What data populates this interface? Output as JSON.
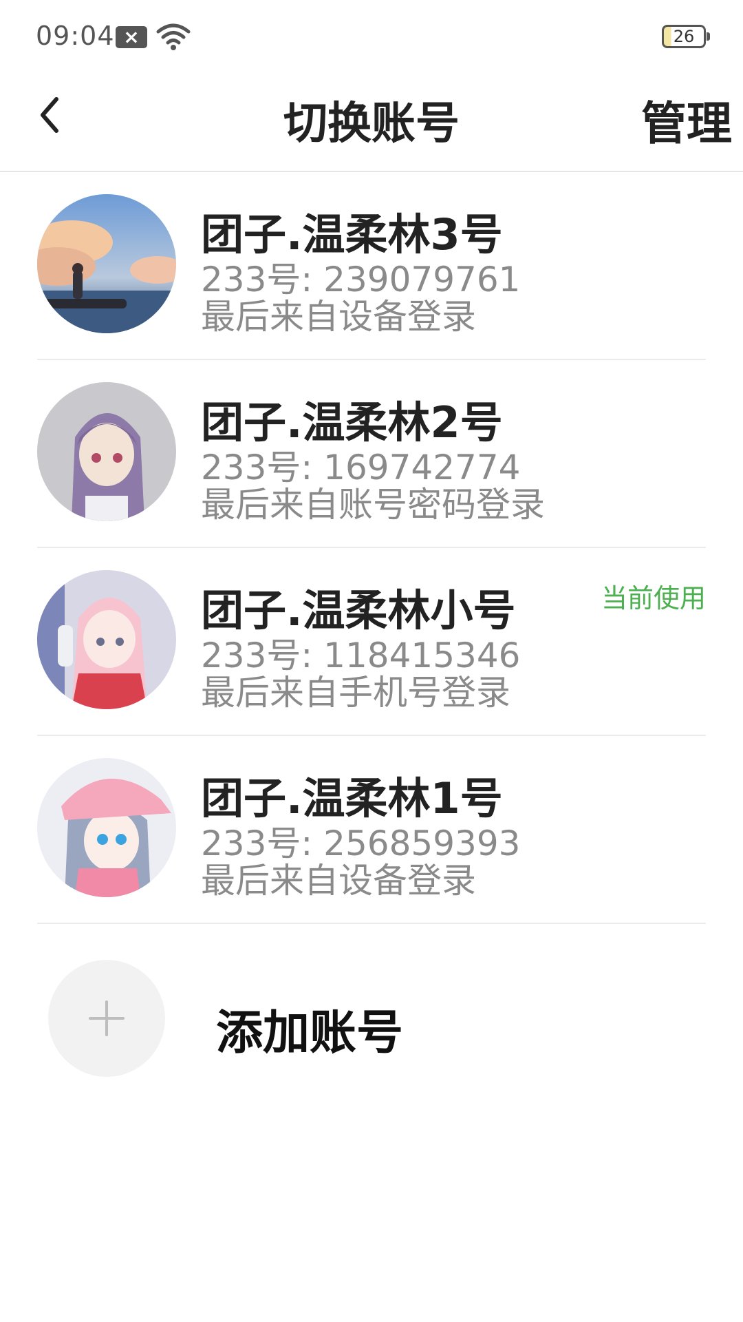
{
  "status_bar": {
    "time": "09:04",
    "battery": "26",
    "notification_icon": "close-box-icon",
    "wifi_icon": "wifi-icon"
  },
  "header": {
    "back_icon": "chevron-left-icon",
    "title": "切换账号",
    "manage_label": "管理"
  },
  "accounts": [
    {
      "name": "团子.温柔林3号",
      "id_text": "233号: 239079761",
      "login_text": "最后来自设备登录",
      "current": ""
    },
    {
      "name": "团子.温柔林2号",
      "id_text": "233号: 169742774",
      "login_text": "最后来自账号密码登录",
      "current": ""
    },
    {
      "name": "团子.温柔林小号",
      "id_text": "233号: 118415346",
      "login_text": "最后来自手机号登录",
      "current": "当前使用"
    },
    {
      "name": "团子.温柔林1号",
      "id_text": "233号: 256859393",
      "login_text": "最后来自设备登录",
      "current": ""
    }
  ],
  "add_account": {
    "label": "添加账号",
    "icon": "plus-icon"
  },
  "colors": {
    "current_badge": "#4caf50",
    "secondary_text": "#8a8a8a",
    "divider": "#ebebeb"
  }
}
